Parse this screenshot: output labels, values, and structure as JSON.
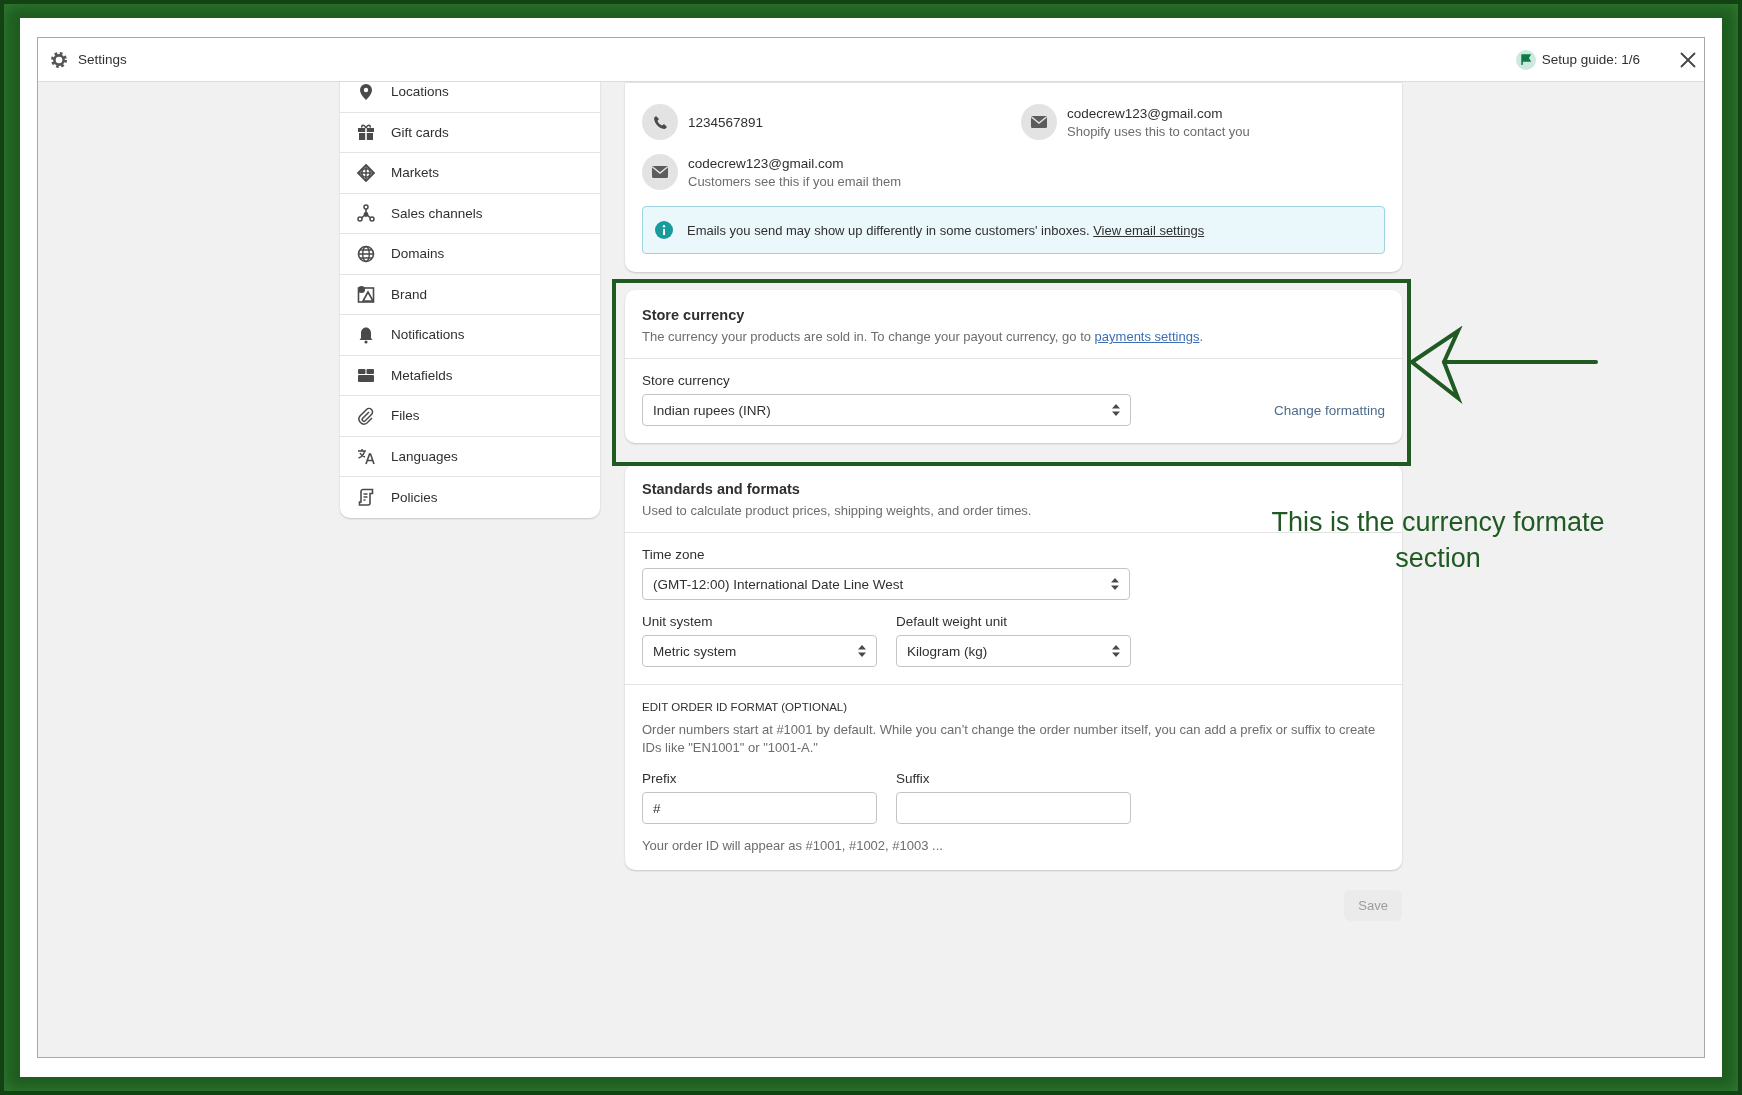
{
  "window": {
    "title": "Settings",
    "setup_guide": "Setup guide: 1/6"
  },
  "sidebar": {
    "items": [
      {
        "label": "Locations"
      },
      {
        "label": "Gift cards"
      },
      {
        "label": "Markets"
      },
      {
        "label": "Sales channels"
      },
      {
        "label": "Domains"
      },
      {
        "label": "Brand"
      },
      {
        "label": "Notifications"
      },
      {
        "label": "Metafields"
      },
      {
        "label": "Files"
      },
      {
        "label": "Languages"
      },
      {
        "label": "Policies"
      }
    ]
  },
  "contact": {
    "phone": "1234567891",
    "store_email": {
      "address": "codecrew123@gmail.com",
      "note": "Shopify uses this to contact you"
    },
    "sender_email": {
      "address": "codecrew123@gmail.com",
      "note": "Customers see this if you email them"
    },
    "banner": {
      "text": "Emails you send may show up differently in some customers' inboxes.",
      "link": "View email settings"
    }
  },
  "store_currency": {
    "title": "Store currency",
    "description": "The currency your products are sold in. To change your payout currency, go to",
    "link": "payments settings",
    "description_end": ".",
    "field_label": "Store currency",
    "value": "Indian rupees (INR)",
    "action": "Change formatting"
  },
  "standards": {
    "title": "Standards and formats",
    "description": "Used to calculate product prices, shipping weights, and order times.",
    "time_zone": {
      "label": "Time zone",
      "value": "(GMT-12:00) International Date Line West"
    },
    "unit_system": {
      "label": "Unit system",
      "value": "Metric system"
    },
    "weight_unit": {
      "label": "Default weight unit",
      "value": "Kilogram (kg)"
    },
    "order_id": {
      "heading": "EDIT ORDER ID FORMAT (OPTIONAL)",
      "description": "Order numbers start at #1001 by default. While you can’t change the order number itself, you can add a prefix or suffix to create IDs like \"EN1001\" or \"1001-A.\"",
      "prefix": {
        "label": "Prefix",
        "value": "#"
      },
      "suffix": {
        "label": "Suffix"
      },
      "preview": "Your order ID will appear as #1001, #1002, #1003 ..."
    }
  },
  "save": {
    "label": "Save",
    "disabled": true
  },
  "annotation": {
    "text": "This is the currency formate section"
  }
}
